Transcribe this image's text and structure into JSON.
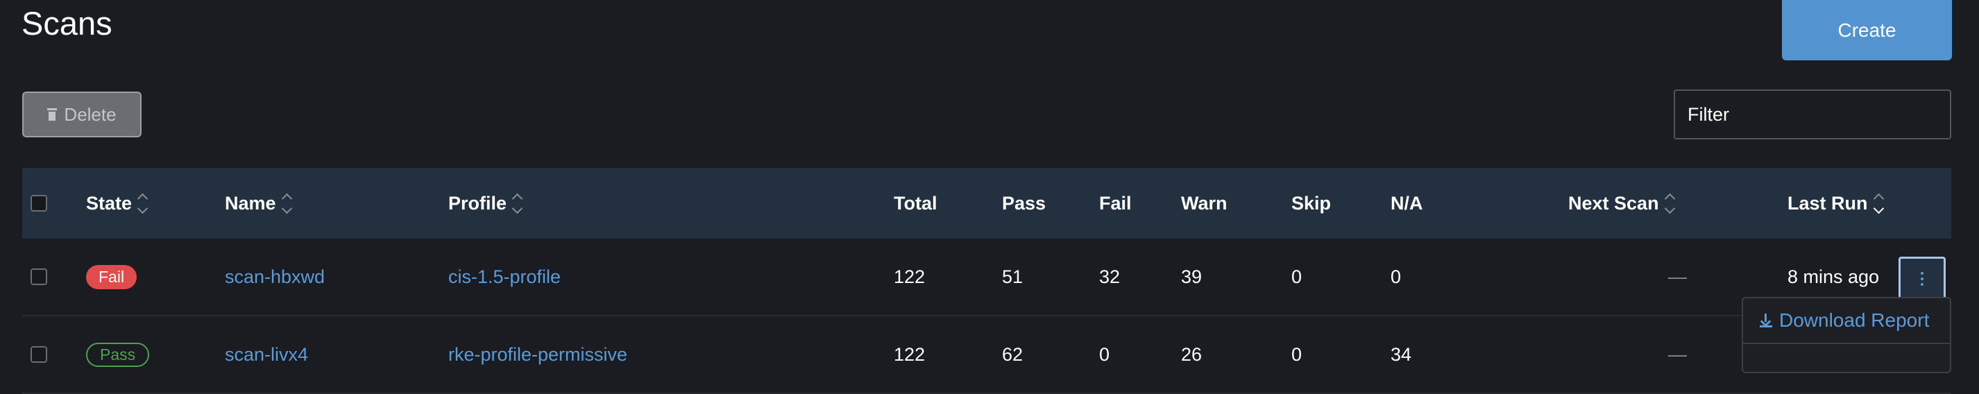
{
  "page": {
    "title": "Scans"
  },
  "toolbar": {
    "create_label": "Create",
    "delete_label": "Delete",
    "filter_placeholder": "Filter"
  },
  "table": {
    "headers": {
      "state": "State",
      "name": "Name",
      "profile": "Profile",
      "total": "Total",
      "pass": "Pass",
      "fail": "Fail",
      "warn": "Warn",
      "skip": "Skip",
      "na": "N/A",
      "next_scan": "Next Scan",
      "last_run": "Last Run"
    },
    "rows": [
      {
        "state": "Fail",
        "name": "scan-hbxwd",
        "profile": "cis-1.5-profile",
        "total": "122",
        "pass": "51",
        "fail": "32",
        "warn": "39",
        "skip": "0",
        "na": "0",
        "next_scan": "—",
        "last_run": "8 mins ago"
      },
      {
        "state": "Pass",
        "name": "scan-livx4",
        "profile": "rke-profile-permissive",
        "total": "122",
        "pass": "62",
        "fail": "0",
        "warn": "26",
        "skip": "0",
        "na": "34",
        "next_scan": "—",
        "last_run": ""
      }
    ]
  },
  "menu": {
    "download_report": "Download Report"
  },
  "colors": {
    "accent": "#5394d0",
    "header_bg": "#22303f",
    "fail": "#e04b4b",
    "pass": "#4ea24e",
    "bg": "#1b1c21"
  }
}
